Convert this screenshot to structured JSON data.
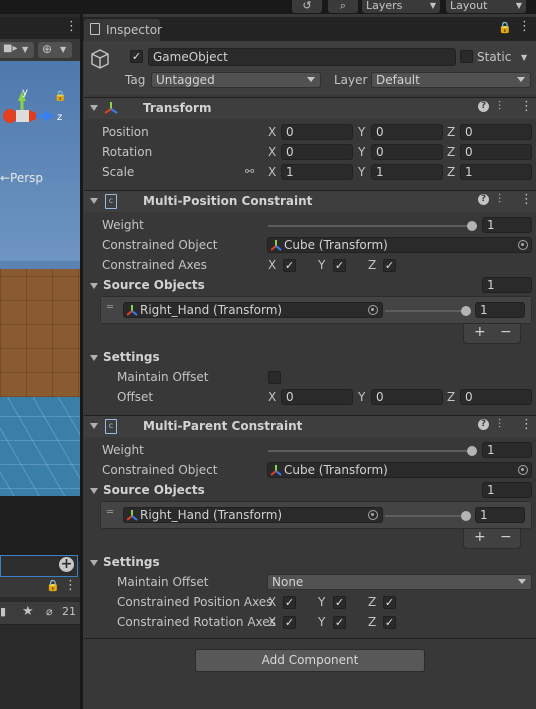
{
  "toolbar": {
    "layers_label": "Layers",
    "layout_label": "Layout"
  },
  "scene": {
    "axis_y": "y",
    "axis_z": "z",
    "projection_label": "←Persp",
    "layer_count": "21"
  },
  "inspector": {
    "tab_label": "Inspector",
    "object_name": "GameObject",
    "static_label": "Static",
    "tag_label": "Tag",
    "tag_value": "Untagged",
    "layer_label": "Layer",
    "layer_value": "Default",
    "transform": {
      "title": "Transform",
      "rows": [
        {
          "label": "Position",
          "x": "0",
          "y": "0",
          "z": "0"
        },
        {
          "label": "Rotation",
          "x": "0",
          "y": "0",
          "z": "0"
        },
        {
          "label": "Scale",
          "x": "1",
          "y": "1",
          "z": "1"
        }
      ]
    },
    "multi_position": {
      "title": "Multi-Position Constraint",
      "weight_label": "Weight",
      "weight_value": "1",
      "constrained_object_label": "Constrained Object",
      "constrained_object_value": "Cube (Transform)",
      "constrained_axes_label": "Constrained Axes",
      "source_objects_label": "Source Objects",
      "source_objects_count": "1",
      "source_item_name": "Right_Hand (Transform)",
      "source_item_weight": "1",
      "settings_label": "Settings",
      "maintain_offset_label": "Maintain Offset",
      "offset_label": "Offset",
      "offset_x": "0",
      "offset_y": "0",
      "offset_z": "0"
    },
    "multi_parent": {
      "title": "Multi-Parent Constraint",
      "weight_label": "Weight",
      "weight_value": "1",
      "constrained_object_label": "Constrained Object",
      "constrained_object_value": "Cube (Transform)",
      "source_objects_label": "Source Objects",
      "source_objects_count": "1",
      "source_item_name": "Right_Hand (Transform)",
      "source_item_weight": "1",
      "settings_label": "Settings",
      "maintain_offset_label": "Maintain Offset",
      "maintain_offset_value": "None",
      "position_axes_label": "Constrained Position Axes",
      "rotation_axes_label": "Constrained Rotation Axes"
    },
    "axis_labels": {
      "x": "X",
      "y": "Y",
      "z": "Z"
    },
    "list_add": "+",
    "list_remove": "−",
    "add_component_label": "Add Component"
  },
  "colors": {
    "inspector_bg": "#383838",
    "field_bg": "#2a2a2a",
    "header_bg": "#3e3e3e",
    "scene_ground": "#8a5a30",
    "scene_water": "#3a7fa8",
    "selection_blue": "#3d7fc4"
  },
  "icons": {
    "history": "history-icon",
    "search": "search-icon",
    "lock": "lock-icon",
    "kebab": "kebab-menu-icon",
    "gizmo": "scene-gizmo-icon",
    "camera": "camera-icon",
    "gameobject": "cube-icon",
    "transform": "transform-axes-icon",
    "constraint": "constraint-script-icon",
    "help": "help-icon",
    "presets": "presets-sliders-icon",
    "link": "link-scale-icon",
    "object_picker": "object-picker-icon",
    "drag_handle": "drag-handle-icon"
  }
}
